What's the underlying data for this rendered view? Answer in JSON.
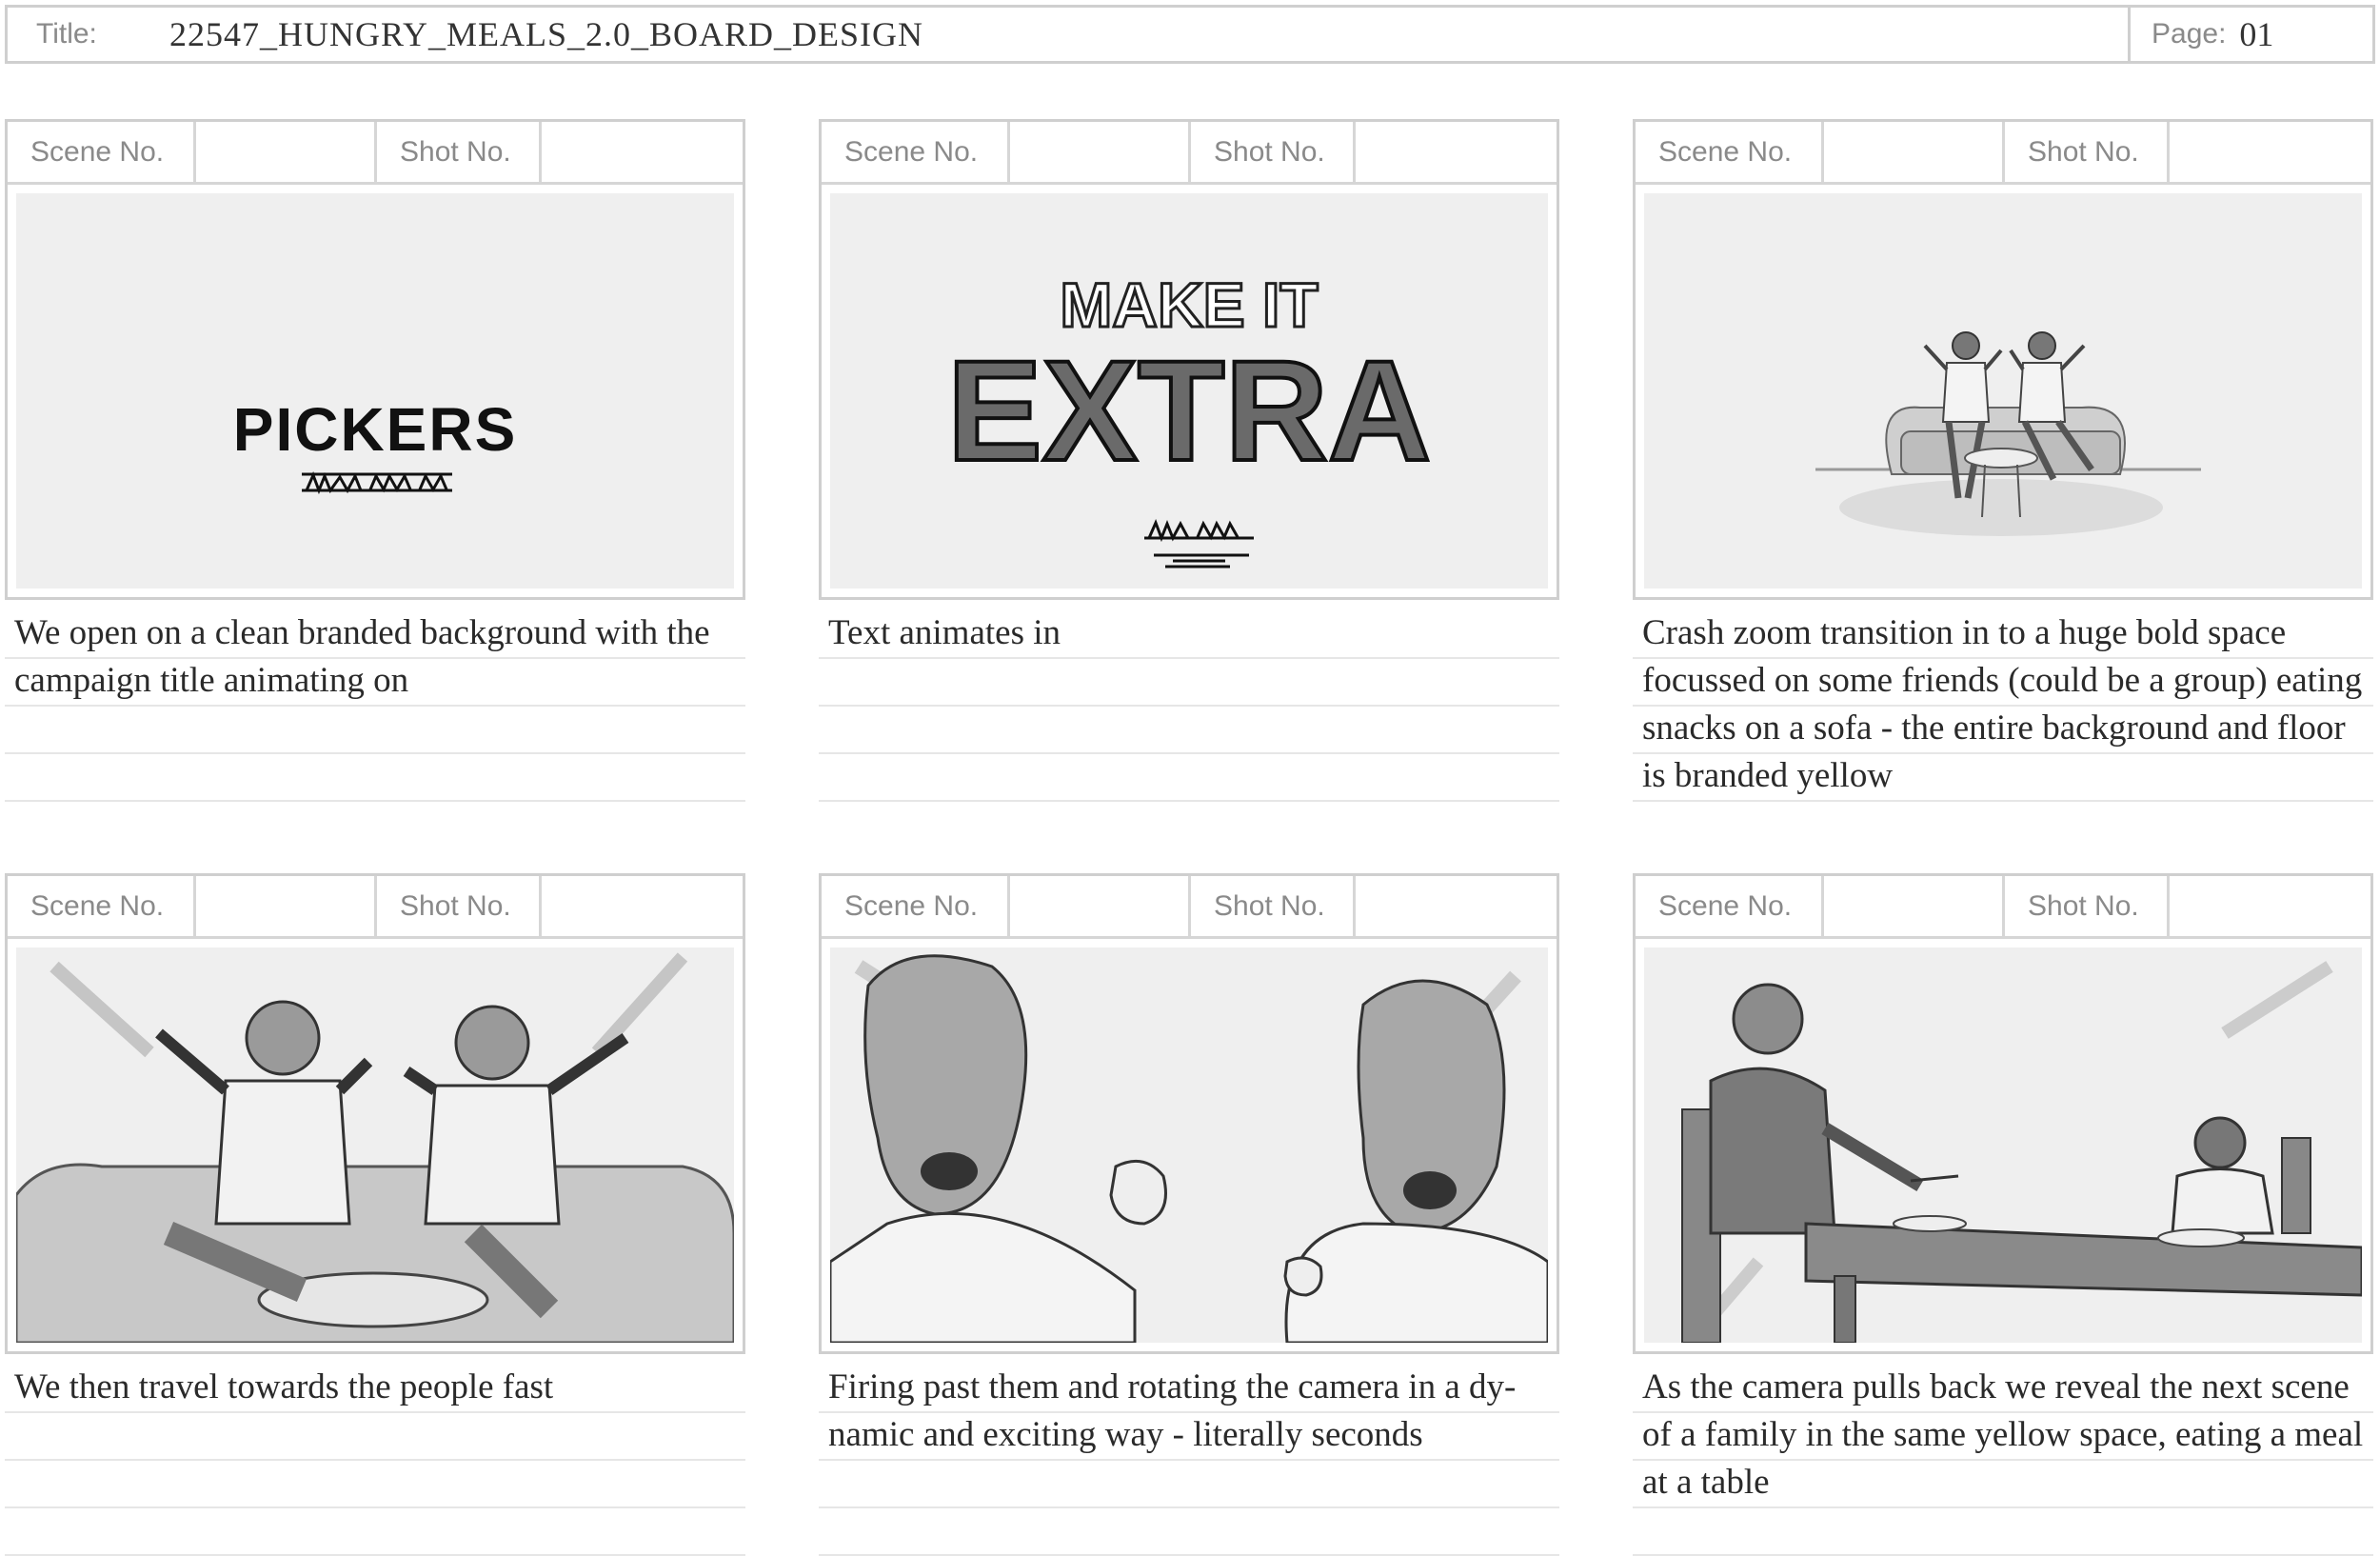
{
  "header": {
    "title_label": "Title:",
    "title_value": "22547_HUNGRY_MEALS_2.0_BOARD_DESIGN",
    "page_label": "Page:",
    "page_value": "01"
  },
  "panel_labels": {
    "scene": "Scene No.",
    "shot": "Shot No."
  },
  "panels": [
    {
      "scene_no": "",
      "shot_no": "",
      "logo_text": "PICKERS",
      "description": "We  open on a clean branded background with the campaign title animating on"
    },
    {
      "scene_no": "",
      "shot_no": "",
      "headline_top": "MAKE IT",
      "headline_main": "EXTRA",
      "description": "Text animates in"
    },
    {
      "scene_no": "",
      "shot_no": "",
      "description": "Crash zoom transition in to a huge bold space focussed on some friends (could be a group) eating snacks on a sofa - the entire background and floor is branded yellow"
    },
    {
      "scene_no": "",
      "shot_no": "",
      "description": "We then travel towards the people fast"
    },
    {
      "scene_no": "",
      "shot_no": "",
      "description": "Firing past them and rotating the camera in a dy-namic and exciting way - literally seconds"
    },
    {
      "scene_no": "",
      "shot_no": "",
      "description": "As the camera pulls back we reveal the next scene of a family in the same yellow space, eating a meal at a table"
    }
  ]
}
